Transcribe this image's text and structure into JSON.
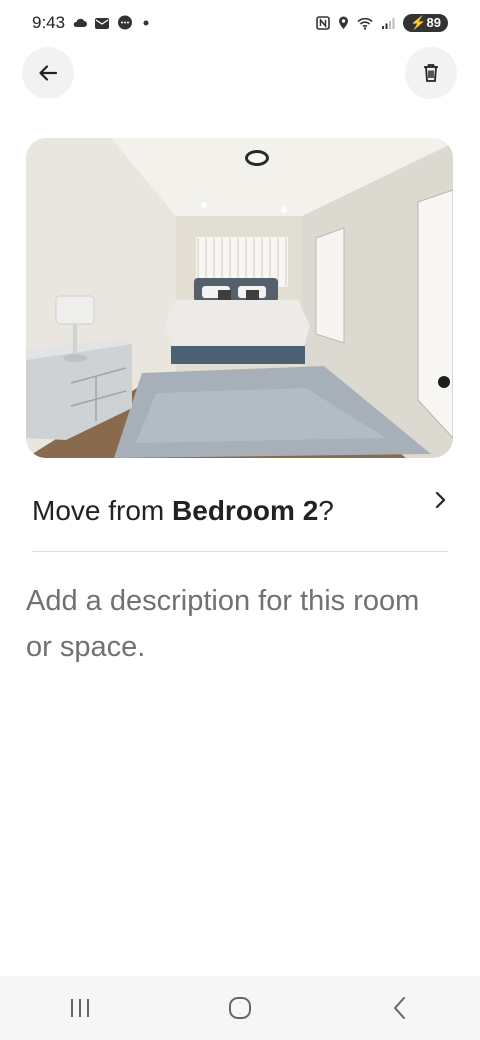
{
  "status_bar": {
    "time": "9:43",
    "left_icons": [
      "cloud-icon",
      "mail-icon",
      "chat-icon",
      "dot-icon"
    ],
    "right_icons": [
      "nfc-icon",
      "location-icon",
      "wifi-icon",
      "signal-icon"
    ],
    "battery": "89"
  },
  "header": {
    "back_icon": "arrow-left-icon",
    "delete_icon": "trash-icon"
  },
  "photo": {
    "subject": "bedroom"
  },
  "move": {
    "prefix": "Move from ",
    "room": "Bedroom 2",
    "suffix": "?",
    "chevron_icon": "chevron-right-icon"
  },
  "description": {
    "placeholder": "Add a description for this room or space."
  },
  "nav": {
    "icons": [
      "recents-icon",
      "home-icon",
      "back-nav-icon"
    ]
  }
}
